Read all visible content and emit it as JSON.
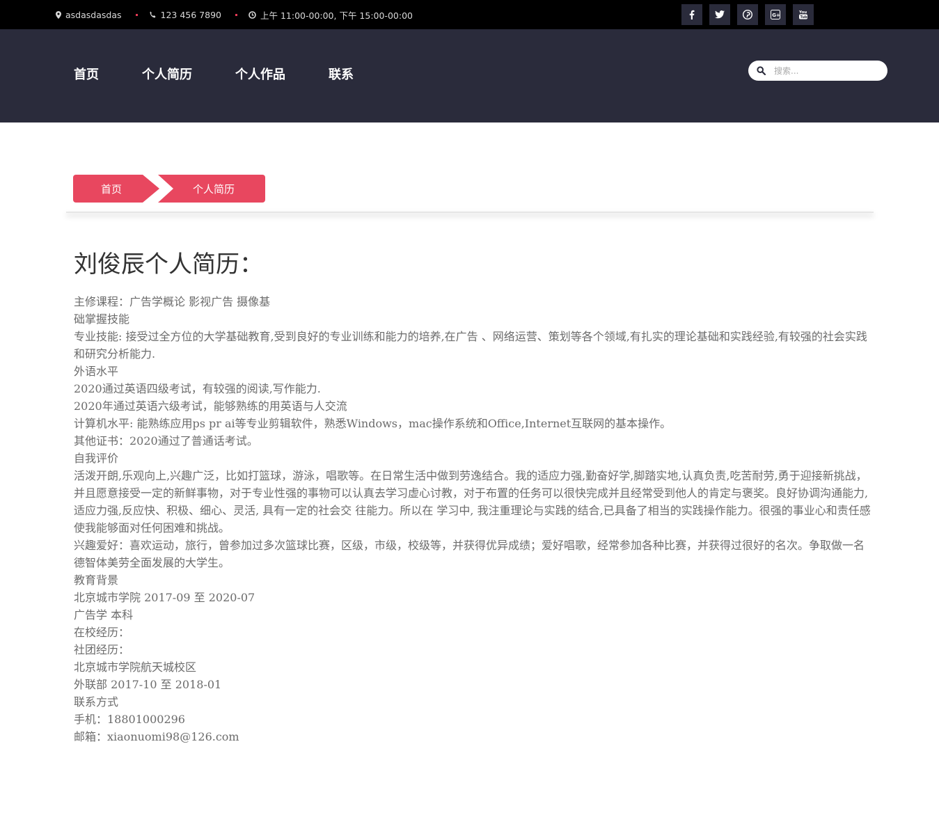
{
  "topbar": {
    "location": "asdasdasdas",
    "phone": "123 456 7890",
    "hours": "上午 11:00-00:00, 下午 15:00-00:00",
    "socials": [
      {
        "name": "facebook-icon",
        "glyph": "f"
      },
      {
        "name": "twitter-icon",
        "glyph": "t"
      },
      {
        "name": "pinterest-icon",
        "glyph": "p"
      },
      {
        "name": "google-plus-icon",
        "glyph": "G+"
      },
      {
        "name": "youtube-icon",
        "glyph": "You"
      }
    ]
  },
  "nav": {
    "items": [
      "首页",
      "个人简历",
      "个人作品",
      "联系"
    ]
  },
  "search": {
    "placeholder": "搜索..."
  },
  "breadcrumb": {
    "home": "首页",
    "current": "个人简历"
  },
  "page": {
    "title": "刘俊辰个人简历："
  },
  "content": {
    "lines": [
      "主修课程：广告学概论 影视广告 摄像基",
      "础掌握技能",
      "专业技能: 接受过全方位的大学基础教育,受到良好的专业训练和能力的培养,在广告 、网络运营、策划等各个领域,有扎实的理论基础和实践经验,有较强的社会实践和研究分析能力.",
      "外语水平",
      "2020通过英语四级考试，有较强的阅读,写作能力.",
      "2020年通过英语六级考试，能够熟练的用英语与人交流",
      "计算机水平: 能熟练应用ps pr ai等专业剪辑软件，熟悉Windows，mac操作系统和Office,Internet互联网的基本操作。",
      "其他证书：2020通过了普通话考试。",
      "自我评价",
      "活泼开朗,乐观向上,兴趣广泛，比如打篮球，游泳，唱歌等。在日常生活中做到劳逸结合。我的适应力强,勤奋好学,脚踏实地,认真负责,吃苦耐劳,勇于迎接新挑战， 并且愿意接受一定的新鲜事物，对于专业性强的事物可以认真去学习虚心讨教，对于布置的任务可以很快完成并且经常受到他人的肯定与褒奖。良好协调沟通能力, 适应力强,反应快、积极、细心、灵活, 具有一定的社会交 往能力。所以在 学习中, 我注重理论与实践的结合,已具备了相当的实践操作能力。很强的事业心和责任感使我能够面对任何困难和挑战。",
      "兴趣爱好：喜欢运动，旅行，曾参加过多次篮球比赛，区级，市级，校级等，并获得优异成绩；爱好唱歌，经常参加各种比赛，并获得过很好的名次。争取做一名德智体美劳全面发展的大学生。",
      "教育背景",
      "北京城市学院 2017-09 至 2020-07",
      "广告学 本科",
      "在校经历：",
      "社团经历：",
      "北京城市学院航天城校区",
      "外联部 2017-10 至 2018-01",
      "联系方式",
      "手机：18801000296",
      "邮箱：xiaonuomi98@126.com"
    ]
  }
}
